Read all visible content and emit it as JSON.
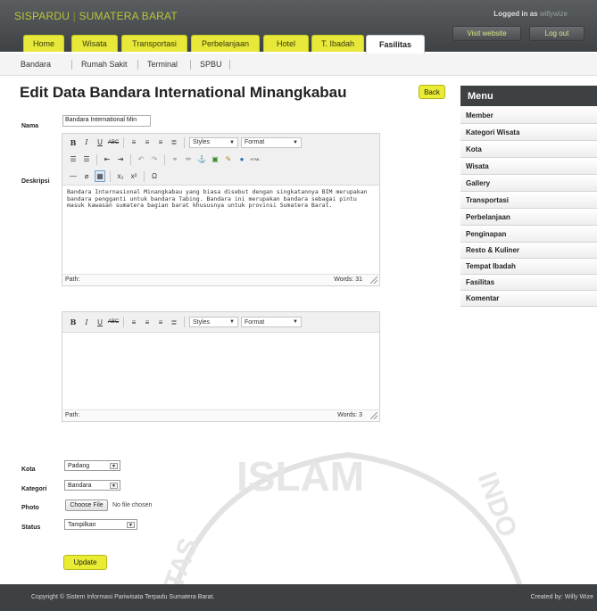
{
  "header": {
    "brand_left": "SISPARDU",
    "brand_sep": "|",
    "brand_right": "SUMATERA BARAT",
    "logged_in_prefix": "Logged in as",
    "logged_in_user": "willywize",
    "visit_label": "Visit website",
    "logout_label": "Log out"
  },
  "tabs": [
    "Home",
    "Wisata",
    "Transportasi",
    "Perbelanjaan",
    "Hotel",
    "T. Ibadah",
    "Fasilitas"
  ],
  "active_tab": "Fasilitas",
  "subnav": [
    "Bandara",
    "Rumah Sakit",
    "Terminal",
    "SPBU"
  ],
  "page": {
    "title": "Edit Data Bandara International Minangkabau",
    "back_label": "Back"
  },
  "form": {
    "nama_label": "Nama",
    "nama_value": "Bandara International Min",
    "deskripsi_label": "Deskripsi",
    "editor1": {
      "styles": "Styles",
      "format": "Format",
      "content": "Bandara Internasional Minangkabau yang biasa disebut dengan singkatannya BIM merupakan bandara pengganti untuk bandara Tabing. Bandara ini merupakan bandara sebagai pintu masuk kawasan sumatera bagian barat khususnya untuk provinsi Sumatera Barat.",
      "path": "Path:",
      "words": "Words: 31"
    },
    "editor2": {
      "styles": "Styles",
      "format": "Format",
      "content": "",
      "path": "Path:",
      "words": "Words: 3"
    },
    "kota_label": "Kota",
    "kota_value": "Padang",
    "kategori_label": "Kategori",
    "kategori_value": "Bandara",
    "photo_label": "Photo",
    "choose_file": "Choose File",
    "no_file": "No file chosen",
    "status_label": "Status",
    "status_value": "Tampilkan",
    "update_label": "Update"
  },
  "sidebar": {
    "title": "Menu",
    "items": [
      "Member",
      "Kategori Wisata",
      "Kota",
      "Wisata",
      "Gallery",
      "Transportasi",
      "Perbelanjaan",
      "Penginapan",
      "Resto & Kuliner",
      "Tempat Ibadah",
      "Fasilitas",
      "Komentar"
    ]
  },
  "footer": {
    "copyright": "Copyright © Sistem Informasi Pariwisata Terpadu Sumatera Barat.",
    "credit": "Created by: Willy Wize"
  },
  "watermark": {
    "text_main": "ISLAM",
    "text_left": "TAS",
    "text_right": "INDO"
  },
  "colors": {
    "accent_yellow": "#e7e83a",
    "header_dark": "#3d4143",
    "brand_green": "#b9c43a"
  }
}
